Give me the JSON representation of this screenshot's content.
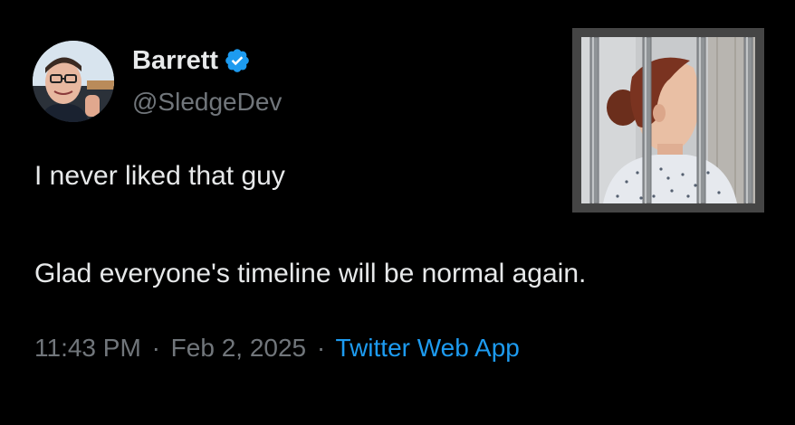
{
  "author": {
    "display_name": "Barrett",
    "handle": "@SledgeDev",
    "verified_icon": "verified-badge-icon",
    "avatar_icon": "avatar-photo"
  },
  "tweet": {
    "line1": "I never liked that guy",
    "line2": "Glad everyone's timeline will be normal again.",
    "time": "11:43 PM",
    "date": "Feb 2, 2025",
    "separator": "·",
    "source": "Twitter Web App"
  },
  "media": {
    "icon": "jail-bars-photo"
  },
  "colors": {
    "background": "#000000",
    "text_primary": "#e7e9ea",
    "text_secondary": "#71767b",
    "link": "#1d9bf0",
    "verified": "#1d9bf0",
    "media_frame": "#454545"
  }
}
